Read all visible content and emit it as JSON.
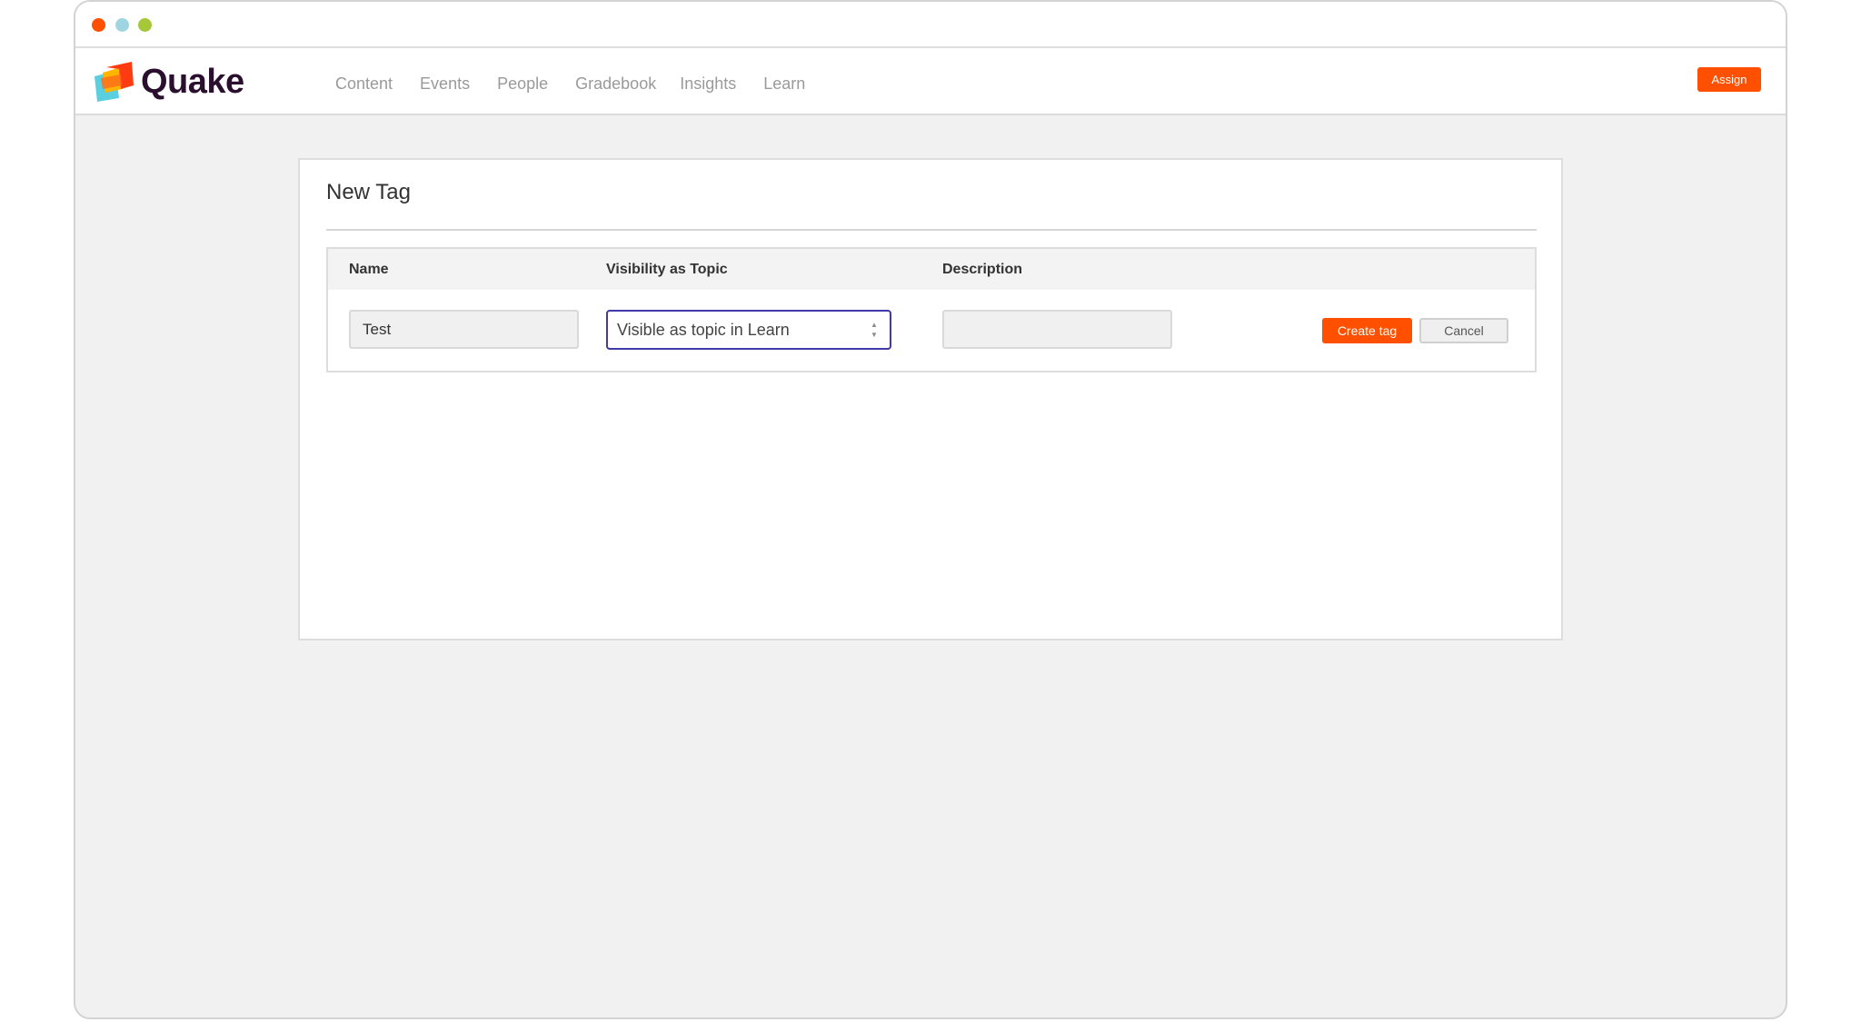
{
  "window": {
    "controls": [
      "close",
      "minimize",
      "maximize"
    ]
  },
  "header": {
    "brand": "Quake",
    "nav": [
      "Content",
      "Events",
      "People",
      "Gradebook",
      "Insights",
      "Learn"
    ],
    "assign_label": "Assign"
  },
  "card": {
    "title": "New Tag",
    "columns": {
      "name": "Name",
      "visibility": "Visibility as Topic",
      "description": "Description"
    },
    "row": {
      "name_value": "Test",
      "visibility_value": "Visible as topic in Learn",
      "description_value": ""
    },
    "create_label": "Create tag",
    "cancel_label": "Cancel"
  },
  "colors": {
    "accent": "#ff4f00",
    "focus_border": "#3f3aa8",
    "brand_text": "#2a0f2e",
    "page_bg": "#f1f1f1"
  },
  "icons": {
    "logo": "quake-logo-icon",
    "stepper": "select-stepper-icon"
  }
}
